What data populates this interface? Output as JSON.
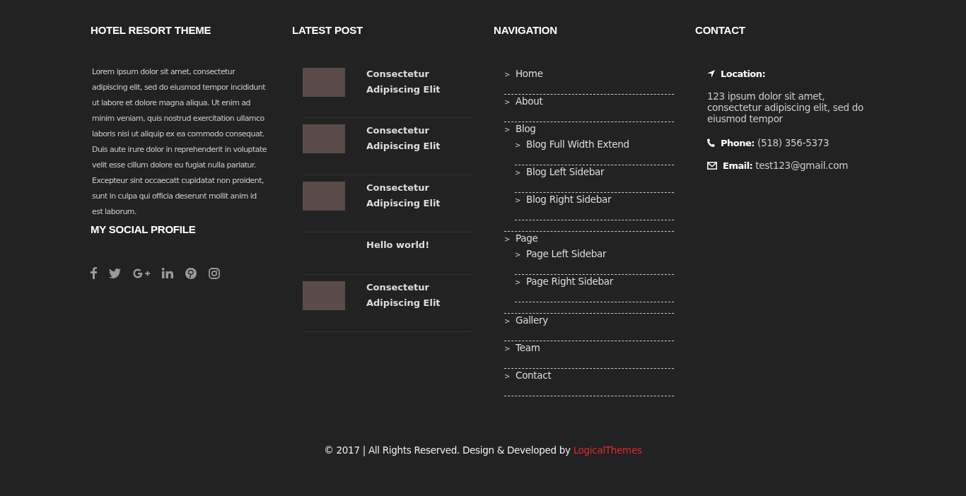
{
  "about": {
    "heading": "HOTEL RESORT THEME",
    "text": "Lorem ipsum dolor sit amet, consectetur adipiscing elit, sed do eiusmod tempor incididunt ut labore et dolore magna aliqua. Ut enim ad minim veniam, quis nostrud exercitation ullamco laboris nisi ut aliquip ex ea commodo consequat. Duis aute irure dolor in reprehenderit in voluptate velit esse cillum dolore eu fugiat nulla pariatur. Excepteur sint occaecatt cupidatat non proident, sunt in culpa qui officia deserunt mollit anim id est laborum."
  },
  "social": {
    "heading": "MY SOCIAL PROFILE",
    "icons": [
      {
        "kind": "facebook"
      },
      {
        "kind": "twitter"
      },
      {
        "kind": "googleplus"
      },
      {
        "kind": "linkedin"
      },
      {
        "kind": "pinterest"
      },
      {
        "kind": "instagram"
      }
    ]
  },
  "latest_post": {
    "heading": "LATEST POST",
    "posts": [
      {
        "title": "Consectetur Adipiscing Elit",
        "thumbnail": true
      },
      {
        "title": "Consectetur Adipiscing Elit",
        "thumbnail": true
      },
      {
        "title": "Consectetur Adipiscing Elit",
        "thumbnail": true
      },
      {
        "title": "Hello world!",
        "thumbnail": false
      },
      {
        "title": "Consectetur Adipiscing Elit",
        "thumbnail": true
      }
    ]
  },
  "navigation": {
    "heading": "NAVIGATION",
    "caret": ">",
    "items": [
      {
        "label": "Home"
      },
      {
        "label": "About"
      },
      {
        "label": "Blog",
        "children": [
          {
            "label": "Blog Full Width Extend"
          },
          {
            "label": "Blog Left Sidebar"
          },
          {
            "label": "Blog Right Sidebar"
          }
        ]
      },
      {
        "label": "Page",
        "children": [
          {
            "label": "Page Left Sidebar"
          },
          {
            "label": "Page Right Sidebar"
          }
        ]
      },
      {
        "label": "Gallery"
      },
      {
        "label": "Team"
      },
      {
        "label": "Contact"
      }
    ]
  },
  "contact": {
    "heading": "CONTACT",
    "location_label": "Location:",
    "address": "123 ipsum dolor sit amet, consectetur adipiscing elit, sed do eiusmod tempor",
    "phone_label": "Phone:",
    "phone": "(518) 356-5373",
    "email_label": "Email:",
    "email": "test123@gmail.com"
  },
  "footer": {
    "text": "© 2017 | All Rights Reserved. Design & Developed by",
    "link": "LogicalThemes"
  }
}
